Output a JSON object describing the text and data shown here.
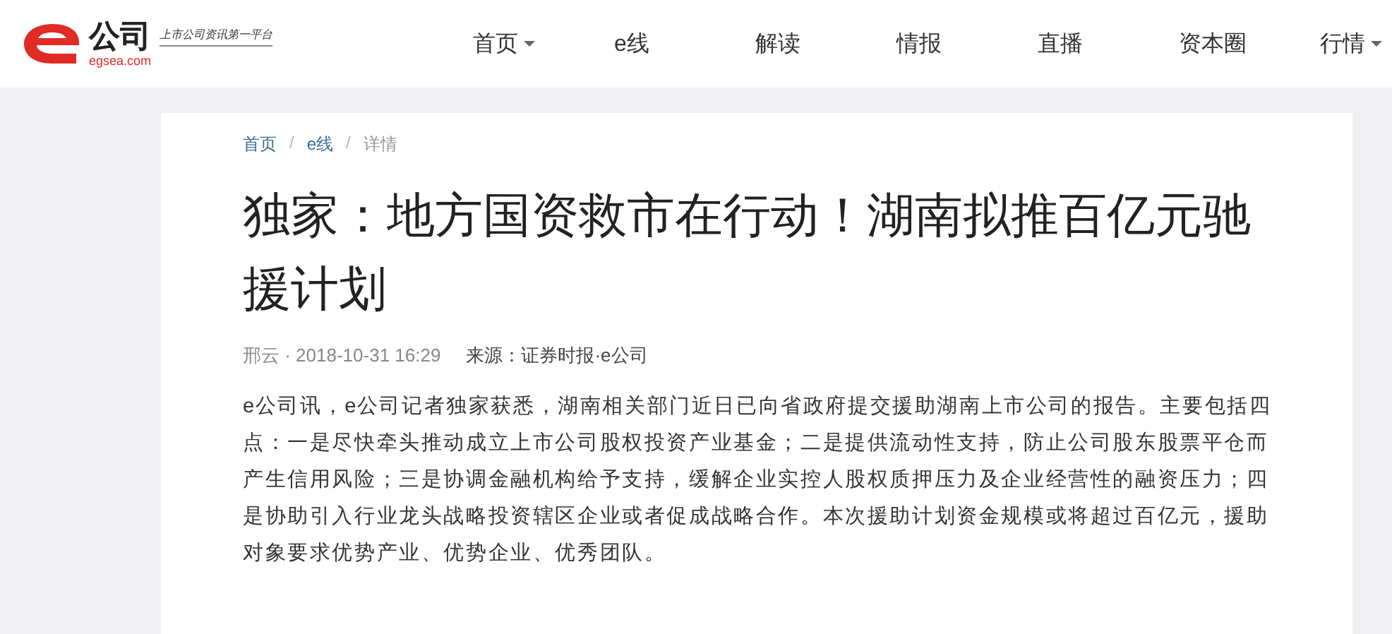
{
  "logo": {
    "brand": "公司",
    "slogan": "上市公司资讯第一平台",
    "domain": "egsea.com"
  },
  "nav": [
    {
      "label": "首页",
      "dropdown": true
    },
    {
      "label": "e线",
      "dropdown": false
    },
    {
      "label": "解读",
      "dropdown": false
    },
    {
      "label": "情报",
      "dropdown": false
    },
    {
      "label": "直播",
      "dropdown": false
    },
    {
      "label": "资本圈",
      "dropdown": false
    },
    {
      "label": "行情",
      "dropdown": true
    }
  ],
  "breadcrumb": [
    "首页",
    "e线",
    "详情"
  ],
  "breadcrumb_separator": "/",
  "article": {
    "title": "独家：地方国资救市在行动！湖南拟推百亿元驰援计划",
    "byline": "邢云 · 2018-10-31 16:29",
    "source": "来源：证券时报·e公司",
    "body": "e公司讯，e公司记者独家获悉，湖南相关部门近日已向省政府提交援助湖南上市公司的报告。主要包括四点：一是尽快牵头推动成立上市公司股权投资产业基金；二是提供流动性支持，防止公司股东股票平仓而产生信用风险；三是协调金融机构给予支持，缓解企业实控人股权质押压力及企业经营性的融资压力；四是协助引入行业龙头战略投资辖区企业或者促成战略合作。本次援助计划资金规模或将超过百亿元，援助对象要求优势产业、优势企业、优秀团队。"
  }
}
